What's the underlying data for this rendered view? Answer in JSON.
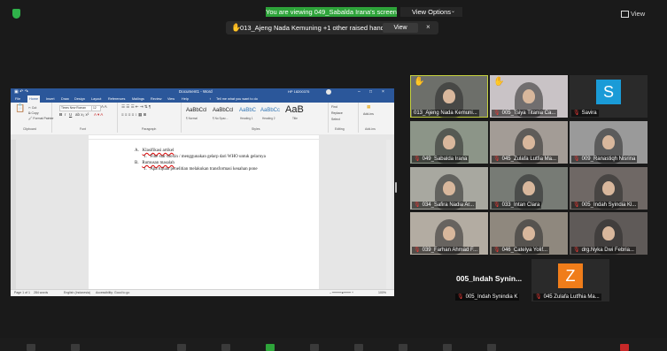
{
  "banner": {
    "viewing_text": "You are viewing 049_Sabalda Irana's screen",
    "view_options_label": "View Options",
    "view_label": "View"
  },
  "raise_hand": {
    "text": "013_Ajeng Nada Kemuning +1 other raised hands",
    "view_button": "View",
    "close": "×"
  },
  "word": {
    "title": "Document1 - Word",
    "user": "HP 18200375",
    "tabs": [
      "File",
      "Home",
      "Insert",
      "Draw",
      "Design",
      "Layout",
      "References",
      "Mailings",
      "Review",
      "View",
      "Help"
    ],
    "tell_me": "Tell me what you want to do",
    "ribbon": {
      "font_name": "Times New Roman",
      "font_size": "12",
      "groups": [
        "Clipboard",
        "Font",
        "Paragraph",
        "Styles",
        "Editing",
        "Add-ins"
      ],
      "styles": [
        {
          "sample": "AaBbCcl",
          "label": "¶ Normal"
        },
        {
          "sample": "AaBbCcl",
          "label": "¶ No Spac..."
        },
        {
          "sample": "AaBbC",
          "label": "Heading 1"
        },
        {
          "sample": "AaBbCc",
          "label": "Heading 2"
        },
        {
          "sample": "AaB",
          "label": "Title"
        }
      ],
      "editing": [
        "Find",
        "Replace",
        "Select"
      ],
      "addins": "Add-ins"
    },
    "doc_lines": [
      {
        "marker": "A.",
        "text": "Klasifikasi artikel"
      },
      {
        "marker": "1.",
        "text": "Fine star dioxin / menggunakan gelarp dari WHO untuk gelarnya"
      },
      {
        "marker": "B.",
        "text": "Rumusan masalah"
      },
      {
        "marker": "1.",
        "text": "Apa tujuan penelitian melakukan transformasi keuahan pone"
      }
    ],
    "status": {
      "page": "Page 1 of 1",
      "words": "284 words",
      "language": "English (Indonesia)",
      "accessibility": "Accessibility: Good to go",
      "zoom": "100%"
    }
  },
  "participants": [
    {
      "name": "013_Ajeng Nada Kemuni...",
      "muted": false,
      "hand": true,
      "active": true,
      "letter": "",
      "color": "#6d6f6a"
    },
    {
      "name": "005_Tsiya Titania Ca...",
      "muted": true,
      "hand": true,
      "active": false,
      "letter": "",
      "color": "#c9c3c6"
    },
    {
      "name": "Savira",
      "muted": true,
      "hand": false,
      "active": false,
      "letter": "S",
      "color": "#1a9bd7"
    },
    {
      "name": "049_Sabalda Irana",
      "muted": true,
      "hand": false,
      "active": false,
      "letter": "",
      "color": "#8c9588"
    },
    {
      "name": "045_Zulafa Lutfia Ma...",
      "muted": true,
      "hand": false,
      "active": false,
      "letter": "",
      "color": "#a39c96"
    },
    {
      "name": "009_Ranastiqh Nisrina",
      "muted": true,
      "hand": false,
      "active": false,
      "letter": "",
      "color": "#9a9a9a"
    },
    {
      "name": "034_Safira Nadia Ar...",
      "muted": true,
      "hand": false,
      "active": false,
      "letter": "",
      "color": "#a8a8a0"
    },
    {
      "name": "033_Intan Clara",
      "muted": true,
      "hand": false,
      "active": false,
      "letter": "",
      "color": "#777b75"
    },
    {
      "name": "005_Indah Syindia Kl...",
      "muted": true,
      "hand": false,
      "active": false,
      "letter": "",
      "color": "#6f6865"
    },
    {
      "name": "039_Farhan Ahmad F...",
      "muted": true,
      "hand": false,
      "active": false,
      "letter": "",
      "color": "#b3aca2"
    },
    {
      "name": "046_Catelya Yolif...",
      "muted": true,
      "hand": false,
      "active": false,
      "letter": "",
      "color": "#8f887e"
    },
    {
      "name": "drg.Nyka Dwi Febria...",
      "muted": true,
      "hand": false,
      "active": false,
      "letter": "",
      "color": "#5f5a58"
    },
    {
      "name": "005_Indah Synindia K",
      "muted": true,
      "hand": false,
      "active": false,
      "letter": "",
      "color": "#1a1a1a"
    },
    {
      "name": "045 Zulafa Lutfhia Ma...",
      "muted": true,
      "hand": false,
      "active": false,
      "letter": "Z",
      "color": "#f07d1a"
    }
  ],
  "big_name": "005_Indah Synin...",
  "colors": {
    "accent_green": "#2ea43a",
    "word_blue": "#2b579a",
    "muted_red": "#e53935",
    "active_border": "#c6d23f"
  }
}
